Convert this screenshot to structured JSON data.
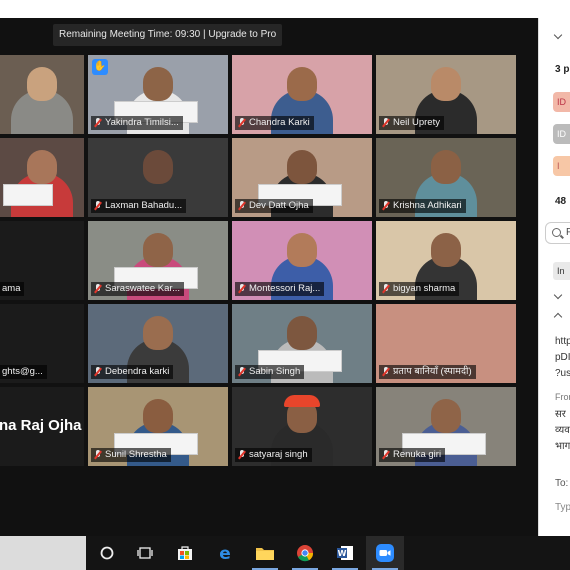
{
  "meeting": {
    "timer_text": "Remaining Meeting Time: 09:30 | Upgrade to Pro"
  },
  "tiles": [
    {
      "name": "",
      "big_name": "",
      "active": true
    },
    {
      "name": "Yakindra Timilsi...",
      "hand_raised": true
    },
    {
      "name": "Chandra Karki"
    },
    {
      "name": "Neil Uprety"
    },
    {
      "name": ""
    },
    {
      "name": "Laxman Bahadu..."
    },
    {
      "name": "Dev Datt Ojha"
    },
    {
      "name": "Krishna Adhikari"
    },
    {
      "name": "ama"
    },
    {
      "name": "Saraswatee Kar..."
    },
    {
      "name": "Montessori Raj..."
    },
    {
      "name": "bigyan sharma"
    },
    {
      "name": "ghts@g..."
    },
    {
      "name": "Debendra karki"
    },
    {
      "name": "Sabin Singh"
    },
    {
      "name": "प्रताप बानियाँ (स्पामदी)"
    },
    {
      "name": "",
      "big_name": "na Raj Ojha"
    },
    {
      "name": "Sunil Shrestha"
    },
    {
      "name": "satyaraj singh"
    },
    {
      "name": "Renuka giri"
    }
  ],
  "chat_panel": {
    "participants_count": "3 p",
    "pill_1": "ID",
    "pill_2": "ID",
    "pill_3": "I",
    "count_48": "48",
    "search_placeholder": "F",
    "chip_text": "In",
    "message_lines": [
      "http",
      "pDI",
      "?us"
    ],
    "from_label": "Fron",
    "body_lines": [
      "सर",
      "व्यव",
      "भाग"
    ],
    "to_label": "To:",
    "type_label": "Typ"
  },
  "taskbar": {
    "apps": [
      "cortana-icon",
      "task-view-icon",
      "store-icon",
      "edge-icon",
      "file-explorer-icon",
      "chrome-icon",
      "word-icon",
      "zoom-icon"
    ]
  }
}
